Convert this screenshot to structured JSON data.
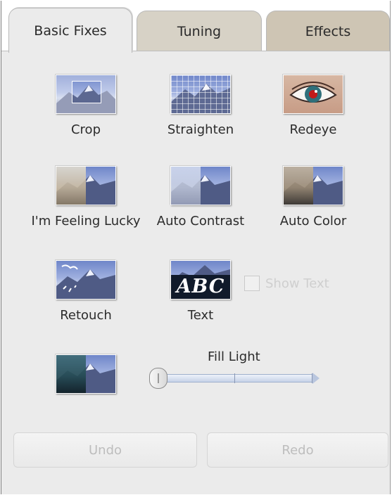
{
  "tabs": [
    {
      "label": "Basic Fixes",
      "active": true
    },
    {
      "label": "Tuning",
      "active": false
    },
    {
      "label": "Effects",
      "active": false
    }
  ],
  "tools": {
    "crop": {
      "label": "Crop",
      "icon": "crop-thumbnail-icon"
    },
    "straighten": {
      "label": "Straighten",
      "icon": "straighten-thumbnail-icon"
    },
    "redeye": {
      "label": "Redeye",
      "icon": "eye-thumbnail-icon"
    },
    "lucky": {
      "label": "I'm Feeling Lucky",
      "icon": "lucky-thumbnail-icon"
    },
    "auto_contrast": {
      "label": "Auto Contrast",
      "icon": "auto-contrast-thumbnail-icon"
    },
    "auto_color": {
      "label": "Auto Color",
      "icon": "auto-color-thumbnail-icon"
    },
    "retouch": {
      "label": "Retouch",
      "icon": "retouch-thumbnail-icon"
    },
    "text": {
      "label": "Text",
      "icon": "text-thumbnail-icon",
      "thumb_text": "ABC"
    }
  },
  "show_text": {
    "label": "Show Text",
    "checked": false,
    "enabled": false
  },
  "fill_light": {
    "label": "Fill Light",
    "value": 0,
    "icon": "fill-light-thumbnail-icon"
  },
  "buttons": {
    "undo": "Undo",
    "redo": "Redo",
    "enabled": false
  },
  "colors": {
    "panel": "#ebebeb",
    "active_tab": "#ebebeb",
    "tab_tuning": "#d7d2c6",
    "tab_effects": "#cec5b4",
    "disabled_text": "#bdbdbd"
  }
}
